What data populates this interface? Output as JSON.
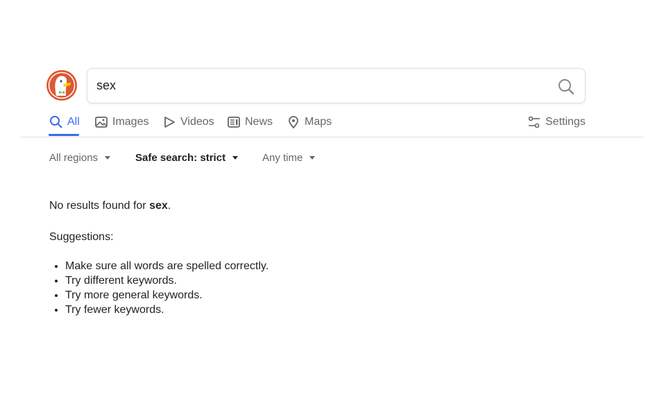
{
  "search": {
    "query": "sex",
    "icon": "search-icon"
  },
  "tabs": [
    {
      "label": "All",
      "icon": "search-icon",
      "active": true
    },
    {
      "label": "Images",
      "icon": "image-icon"
    },
    {
      "label": "Videos",
      "icon": "play-icon"
    },
    {
      "label": "News",
      "icon": "newspaper-icon"
    },
    {
      "label": "Maps",
      "icon": "map-pin-icon"
    }
  ],
  "settings": {
    "label": "Settings",
    "icon": "sliders-icon"
  },
  "filters": {
    "region": "All regions",
    "safe_search": "Safe search: strict",
    "time": "Any time"
  },
  "results": {
    "no_results_prefix": "No results found for ",
    "no_results_query": "sex",
    "no_results_suffix": ".",
    "suggestions_heading": "Suggestions:",
    "suggestions": [
      "Make sure all words are spelled correctly.",
      "Try different keywords.",
      "Try more general keywords.",
      "Try fewer keywords."
    ]
  },
  "colors": {
    "accent": "#3969ef",
    "logo": "#de5833"
  }
}
